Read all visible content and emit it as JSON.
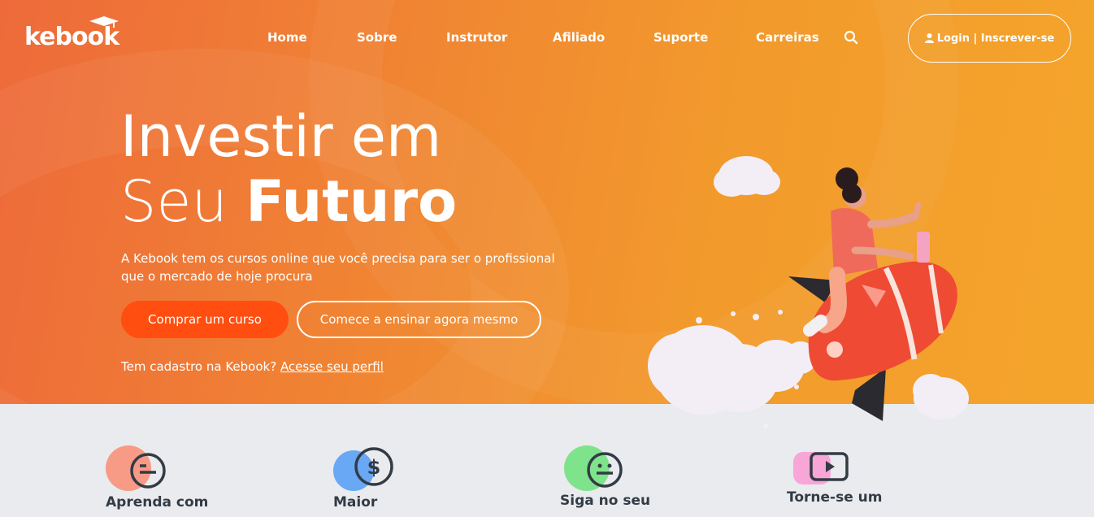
{
  "brand": {
    "name": "kebook"
  },
  "nav": {
    "links": [
      "Home",
      "Sobre",
      "Instrutor",
      "Afiliado",
      "Suporte",
      "Carreiras"
    ],
    "login_label": "Login | Inscrever-se"
  },
  "hero": {
    "headline_line1": "Investir em",
    "headline_line2_light": "Seu ",
    "headline_line2_bold": "Futuro",
    "subtitle": "A Kebook tem os cursos online que você precisa para ser o profissional que o mercado de hoje procura",
    "primary_button": "Comprar um curso",
    "secondary_button": "Comece a ensinar agora mesmo",
    "login_prompt": "Tem cadastro na Kebook? ",
    "login_link": "Acesse seu perfil"
  },
  "features": [
    {
      "label": "Aprenda com",
      "icon": "smiley-icon",
      "color": "#f79a86"
    },
    {
      "label": "Maior",
      "icon": "dollar-icon",
      "color": "#68a8f5"
    },
    {
      "label": "Siga no seu",
      "icon": "smiley-icon",
      "color": "#7ee38a"
    },
    {
      "label": "Torne-se um",
      "icon": "video-icon",
      "color": "#f8a6d8"
    }
  ],
  "colors": {
    "accent": "#ff4e0f",
    "hero_start": "#ee6a3a",
    "hero_end": "#f4a52b"
  }
}
